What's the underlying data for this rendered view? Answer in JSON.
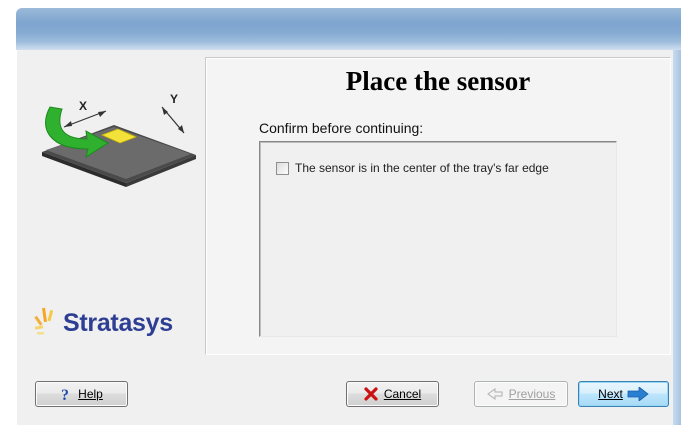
{
  "dialog": {
    "title": "Place the sensor",
    "prompt": "Confirm before continuing:"
  },
  "illustration": {
    "x_label": "X",
    "y_label": "Y"
  },
  "logo": {
    "text": "Stratasys"
  },
  "checklist": [
    {
      "label": "The sensor is in the center of the tray's far edge",
      "checked": false
    }
  ],
  "buttons": {
    "help": {
      "label": "Help",
      "icon": "question-icon"
    },
    "cancel": {
      "label": "Cancel",
      "icon": "red-x-icon"
    },
    "previous": {
      "label": "Previous",
      "icon": "left-arrow-icon",
      "enabled": false
    },
    "next": {
      "label": "Next",
      "icon": "right-arrow-icon"
    }
  },
  "colors": {
    "logo_text": "#2d3e93",
    "arrow_green": "#2fb02f",
    "sensor_yellow": "#f2e23a",
    "cancel_red": "#cc1111",
    "next_arrow": "#2b7fd0"
  }
}
